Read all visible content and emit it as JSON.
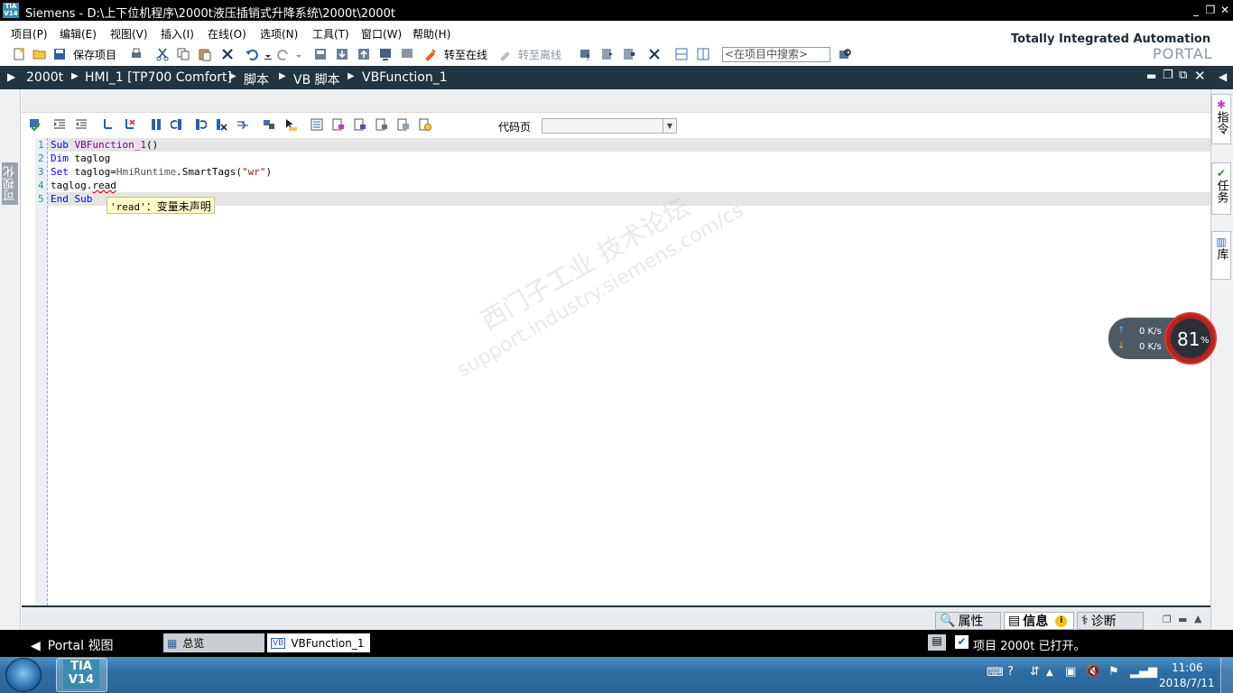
{
  "titlebar": {
    "logo": "TIA V14",
    "title": "Siemens  -  D:\\上下位机程序\\2000t液压插销式升降系统\\2000t\\2000t"
  },
  "menu": [
    "项目(P)",
    "编辑(E)",
    "视图(V)",
    "插入(I)",
    "在线(O)",
    "选项(N)",
    "工具(T)",
    "窗口(W)",
    "帮助(H)"
  ],
  "toolbar": {
    "save_label": "保存项目",
    "go_online": "转至在线",
    "go_offline": "转至离线",
    "search_placeholder": "<在项目中搜索>"
  },
  "brand": {
    "line1": "Totally Integrated Automation",
    "line2": "PORTAL"
  },
  "breadcrumb": [
    "2000t",
    "HMI_1 [TP700 Comfort]",
    "脚本",
    "VB 脚本",
    "VBFunction_1"
  ],
  "left_panel": {
    "label": "可视化"
  },
  "right_tabs": [
    "指令",
    "任务",
    "库"
  ],
  "editor": {
    "codepage_label": "代码页",
    "codepage_value": "",
    "lines": [
      {
        "n": "1",
        "text": "Sub VBFunction_1()"
      },
      {
        "n": "2",
        "text": "Dim taglog"
      },
      {
        "n": "3",
        "text": "Set taglog=HmiRuntime.SmartTags(\"wr\")"
      },
      {
        "n": "4",
        "text": "taglog.read"
      },
      {
        "n": "5",
        "text": "End Sub"
      }
    ],
    "tooltip_code": "'read'",
    "tooltip_msg": "：变量未声明"
  },
  "bottom_tabs": [
    "属性",
    "信息",
    "诊断"
  ],
  "statusbar": {
    "portal_view": "Portal 视图",
    "tabs": [
      "总览",
      "VBFunction_1"
    ],
    "message": "项目 2000t 已打开。"
  },
  "net_widget": {
    "up": "0 K/s",
    "down": "0 K/s",
    "percent": "81",
    "percent_sign": "%"
  },
  "watermark": {
    "line1": "西门子工业  技术论坛",
    "line2": "support.industry.siemens.com/cs"
  },
  "taskbar": {
    "app": "TIA V14",
    "time": "11:06",
    "date": "2018/7/11"
  }
}
